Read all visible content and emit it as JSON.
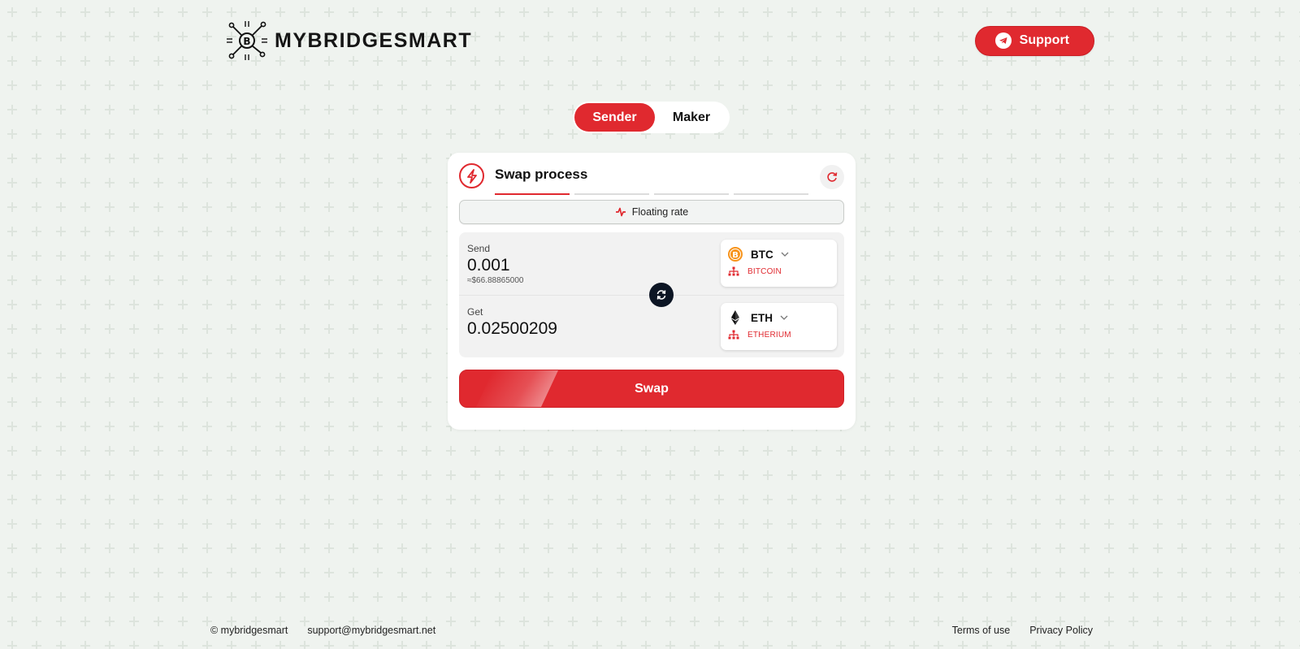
{
  "brand": {
    "name": "MYBRIDGESMART"
  },
  "header": {
    "support_label": "Support"
  },
  "mode_toggle": {
    "sender_label": "Sender",
    "maker_label": "Maker",
    "active": "Sender"
  },
  "card": {
    "title": "Swap process",
    "steps_total": 4,
    "steps_done": 1,
    "rate_label": "Floating rate"
  },
  "send": {
    "label": "Send",
    "amount": "0.001",
    "fiat": "≈$66.88865000",
    "coin": {
      "ticker": "BTC",
      "network": "BITCOIN",
      "icon": "bitcoin-icon",
      "color": "#f7931a"
    }
  },
  "get": {
    "label": "Get",
    "amount": "0.02500209",
    "coin": {
      "ticker": "ETH",
      "network": "ETHERIUM",
      "icon": "ethereum-icon",
      "color": "#3c3c3d"
    }
  },
  "swap_button": {
    "label": "Swap"
  },
  "footer": {
    "copyright": "© mybridgesmart",
    "email": "support@mybridgesmart.net",
    "terms": "Terms of use",
    "privacy": "Privacy Policy"
  },
  "colors": {
    "accent": "#e0292f",
    "dark": "#0c1524",
    "background": "#eff3ef"
  }
}
